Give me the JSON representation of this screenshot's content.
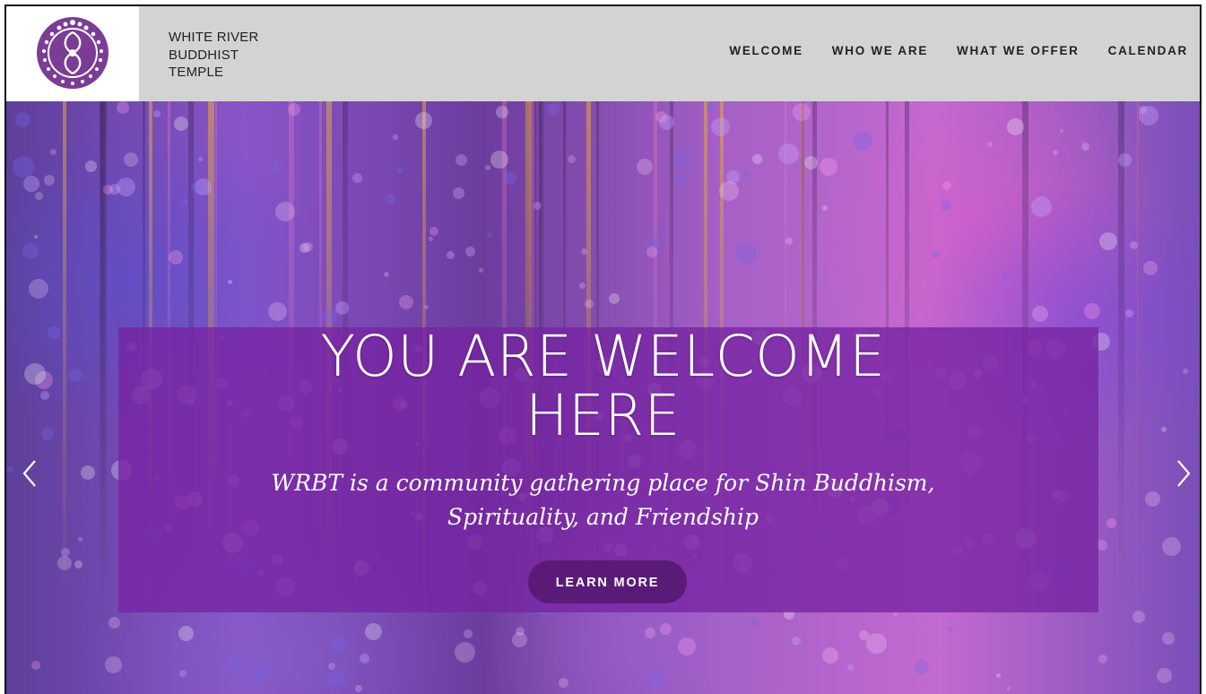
{
  "header": {
    "logo_icon": "wisteria-crest-icon",
    "site_name_lines": [
      "WHITE RIVER",
      "BUDDHIST",
      "TEMPLE"
    ],
    "nav": [
      "WELCOME",
      "WHO WE ARE",
      "WHAT WE OFFER",
      "CALENDAR"
    ]
  },
  "hero": {
    "headline_lines": [
      "YOU ARE WELCOME",
      "HERE"
    ],
    "tagline_lines": [
      "WRBT is a community gathering place for Shin Buddhism,",
      "Spirituality, and Friendship"
    ],
    "cta_label": "LEARN MORE",
    "prev_icon": "chevron-left-icon",
    "next_icon": "chevron-right-icon"
  },
  "colors": {
    "header_bg": "#d3d3d4",
    "logo_purple": "#7b3c96",
    "overlay_purple": "#7624a2",
    "cta_bg": "#5a1b78"
  }
}
